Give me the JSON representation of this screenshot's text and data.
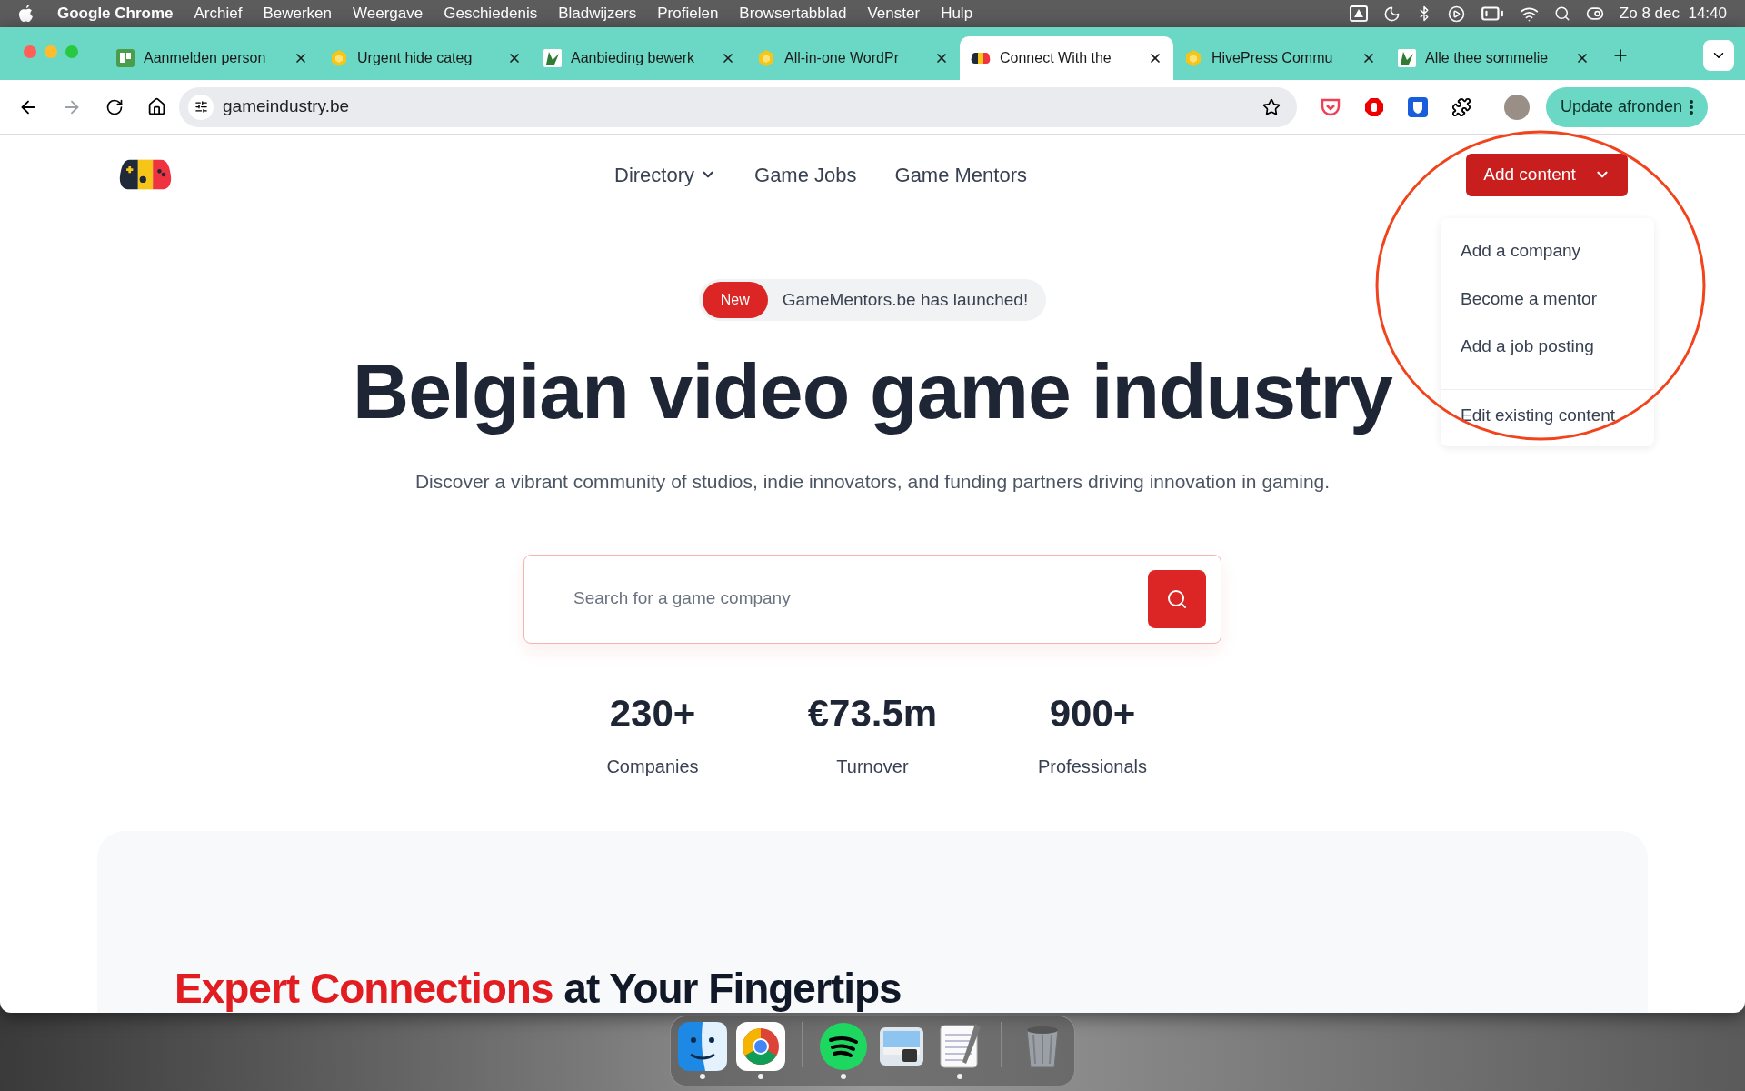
{
  "menubar": {
    "app": "Google Chrome",
    "menus": [
      "Archief",
      "Bewerken",
      "Weergave",
      "Geschiedenis",
      "Bladwijzers",
      "Profielen",
      "Browsertabblad",
      "Venster",
      "Hulp"
    ],
    "clock": "Zo 8 dec  14:40"
  },
  "tabs": [
    {
      "title": "Aanmelden person",
      "kind": "board",
      "selected": false
    },
    {
      "title": "Urgent hide categ",
      "kind": "hive",
      "selected": false
    },
    {
      "title": "Aanbieding bewerk",
      "kind": "leaf",
      "selected": false
    },
    {
      "title": "All-in-one WordPr",
      "kind": "hive",
      "selected": false
    },
    {
      "title": "Connect With the",
      "kind": "gamepad",
      "selected": true
    },
    {
      "title": "HivePress Commu",
      "kind": "hive",
      "selected": false
    },
    {
      "title": "Alle thee sommelie",
      "kind": "leaf",
      "selected": false
    }
  ],
  "address": "gameindustry.be",
  "update_button": "Update afronden",
  "site": {
    "nav": [
      {
        "label": "Directory",
        "dropdown": true
      },
      {
        "label": "Game Jobs",
        "dropdown": false
      },
      {
        "label": "Game Mentors",
        "dropdown": false
      }
    ],
    "add_button": "Add content",
    "menu": {
      "expanded": true,
      "items": [
        "Add a company",
        "Become a mentor",
        "Add a job posting"
      ],
      "footer_item": "Edit existing content"
    },
    "badge": {
      "tag": "New",
      "text": "GameMentors.be has launched!"
    },
    "headline": "Belgian video game industry",
    "subtitle": "Discover a vibrant community of studios, indie innovators, and funding partners driving innovation in gaming.",
    "search": {
      "placeholder": "Search for a game company"
    },
    "stats": [
      {
        "value": "230+",
        "label": "Companies"
      },
      {
        "value": "€73.5m",
        "label": "Turnover"
      },
      {
        "value": "900+",
        "label": "Professionals"
      }
    ],
    "section_heading": {
      "highlight": "Expert Connections",
      "rest": "at Your Fingertips"
    }
  },
  "dock": [
    {
      "kind": "finder",
      "running": true
    },
    {
      "kind": "chrome",
      "running": true
    },
    {
      "kind": "separator"
    },
    {
      "kind": "spotify",
      "running": true
    },
    {
      "kind": "preview",
      "running": false
    },
    {
      "kind": "textedit",
      "running": true
    },
    {
      "kind": "separator"
    },
    {
      "kind": "trash",
      "running": false
    }
  ]
}
